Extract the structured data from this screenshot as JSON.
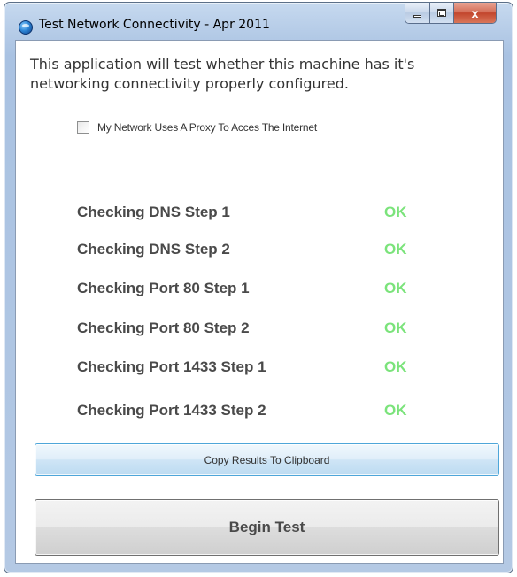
{
  "window": {
    "title": "Test Network Connectivity - Apr 2011",
    "icon": "globe-icon",
    "caption_buttons": {
      "minimize": "minimize-icon",
      "maximize": "maximize-icon",
      "close": "x"
    }
  },
  "main": {
    "intro_text": "This application will test whether this machine has it's networking connectivity properly configured.",
    "proxy_checkbox": {
      "label": "My Network Uses A Proxy To Acces The Internet",
      "checked": false
    },
    "checks": [
      {
        "label": "Checking DNS Step 1",
        "status": "OK"
      },
      {
        "label": "Checking DNS Step 2",
        "status": "OK"
      },
      {
        "label": "Checking Port 80 Step 1",
        "status": "OK"
      },
      {
        "label": "Checking Port 80 Step 2",
        "status": "OK"
      },
      {
        "label": "Checking Port 1433 Step 1",
        "status": "OK"
      },
      {
        "label": "Checking Port 1433 Step 2",
        "status": "OK"
      }
    ],
    "copy_button": "Copy Results To Clipboard",
    "begin_button": "Begin Test"
  },
  "colors": {
    "status_ok": "#7be37b",
    "copy_button_border": "#4ea6d9"
  }
}
